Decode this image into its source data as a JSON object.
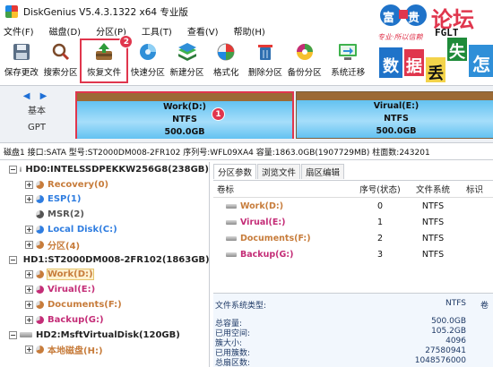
{
  "window": {
    "title": "DiskGenius V5.4.3.1322 x64 专业版"
  },
  "menu": [
    "文件(F)",
    "磁盘(D)",
    "分区(P)",
    "工具(T)",
    "查看(V)",
    "帮助(H)"
  ],
  "toolbar": {
    "buttons": [
      {
        "label": "保存更改",
        "icon": "save-icon"
      },
      {
        "label": "搜索分区",
        "icon": "search-icon"
      },
      {
        "label": "恢复文件",
        "icon": "recover-files-icon"
      },
      {
        "label": "快速分区",
        "icon": "quick-partition-icon"
      },
      {
        "label": "新建分区",
        "icon": "new-partition-icon"
      },
      {
        "label": "格式化",
        "icon": "format-icon"
      },
      {
        "label": "删除分区",
        "icon": "delete-partition-icon"
      },
      {
        "label": "备份分区",
        "icon": "backup-partition-icon"
      },
      {
        "label": "系统迁移",
        "icon": "system-migration-icon"
      }
    ],
    "callout_2": "2"
  },
  "logo": {
    "brand_cn": "论坛",
    "brand_en": "FGLT",
    "blocks": [
      "富",
      "贵",
      "数",
      "据",
      "丢",
      "失",
      "怎"
    ],
    "slogan": "专业·所以信赖"
  },
  "disk_map": {
    "arrows": "◀ ▶",
    "style_line1": "基本",
    "style_line2": "GPT",
    "partitions": [
      {
        "name": "Work(D:)",
        "fs": "NTFS",
        "size": "500.0GB"
      },
      {
        "name": "Virual(E:)",
        "fs": "NTFS",
        "size": "500.0GB"
      }
    ],
    "callout_1": "1"
  },
  "disk_info": "磁盘1 接口:SATA  型号:ST2000DM008-2FR102  序列号:WFL09XA4  容量:1863.0GB(1907729MB)  柱面数:243201",
  "tree": [
    {
      "label": "HD0:INTELSSDPEKKW256G8(238GB)",
      "level": 0,
      "type": "disk",
      "expander": "−"
    },
    {
      "label": "Recovery(0)",
      "level": 1,
      "type": "part",
      "color": "#c77c3b",
      "expander": "+"
    },
    {
      "label": "ESP(1)",
      "level": 1,
      "type": "part",
      "color": "#2f7de0",
      "expander": "+"
    },
    {
      "label": "MSR(2)",
      "level": 1,
      "type": "part",
      "color": "#555555",
      "expander": ""
    },
    {
      "label": "Local Disk(C:)",
      "level": 1,
      "type": "part",
      "color": "#2f7de0",
      "expander": "+"
    },
    {
      "label": "分区(4)",
      "level": 1,
      "type": "part",
      "color": "#c77c3b",
      "expander": "+"
    },
    {
      "label": "HD1:ST2000DM008-2FR102(1863GB)",
      "level": 0,
      "type": "disk",
      "expander": "−"
    },
    {
      "label": "Work(D:)",
      "level": 1,
      "type": "part",
      "color": "#c77c3b",
      "expander": "+",
      "selected": true
    },
    {
      "label": "Virual(E:)",
      "level": 1,
      "type": "part",
      "color": "#c42d77",
      "expander": "+"
    },
    {
      "label": "Documents(F:)",
      "level": 1,
      "type": "part",
      "color": "#c77c3b",
      "expander": "+"
    },
    {
      "label": "Backup(G:)",
      "level": 1,
      "type": "part",
      "color": "#c42d77",
      "expander": "+"
    },
    {
      "label": "HD2:MsftVirtualDisk(120GB)",
      "level": 0,
      "type": "disk",
      "expander": "−"
    },
    {
      "label": "本地磁盘(H:)",
      "level": 1,
      "type": "part",
      "color": "#c77c3b",
      "expander": "+"
    }
  ],
  "tabs": [
    "分区参数",
    "浏览文件",
    "扇区编辑"
  ],
  "partition_table": {
    "headers": [
      "卷标",
      "序号(状态)",
      "文件系统",
      "标识"
    ],
    "rows": [
      {
        "label": "Work(D:)",
        "index": "0",
        "fs": "NTFS"
      },
      {
        "label": "Virual(E:)",
        "index": "1",
        "fs": "NTFS"
      },
      {
        "label": "Documents(F:)",
        "index": "2",
        "fs": "NTFS"
      },
      {
        "label": "Backup(G:)",
        "index": "3",
        "fs": "NTFS"
      }
    ]
  },
  "details": {
    "fs_type_label": "文件系统类型:",
    "fs_type_value": "NTFS",
    "extra": "卷",
    "rows": [
      {
        "label": "总容量:",
        "value": "500.0GB"
      },
      {
        "label": "已用空间:",
        "value": "105.2GB"
      },
      {
        "label": "簇大小:",
        "value": "4096"
      },
      {
        "label": "已用簇数:",
        "value": "27580941"
      },
      {
        "label": "总扇区数:",
        "value": "1048576000"
      }
    ]
  },
  "colors": {
    "highlight": "#e0364d",
    "partition_fill": "#63c2f1",
    "partition_cap": "#9b6a35"
  }
}
